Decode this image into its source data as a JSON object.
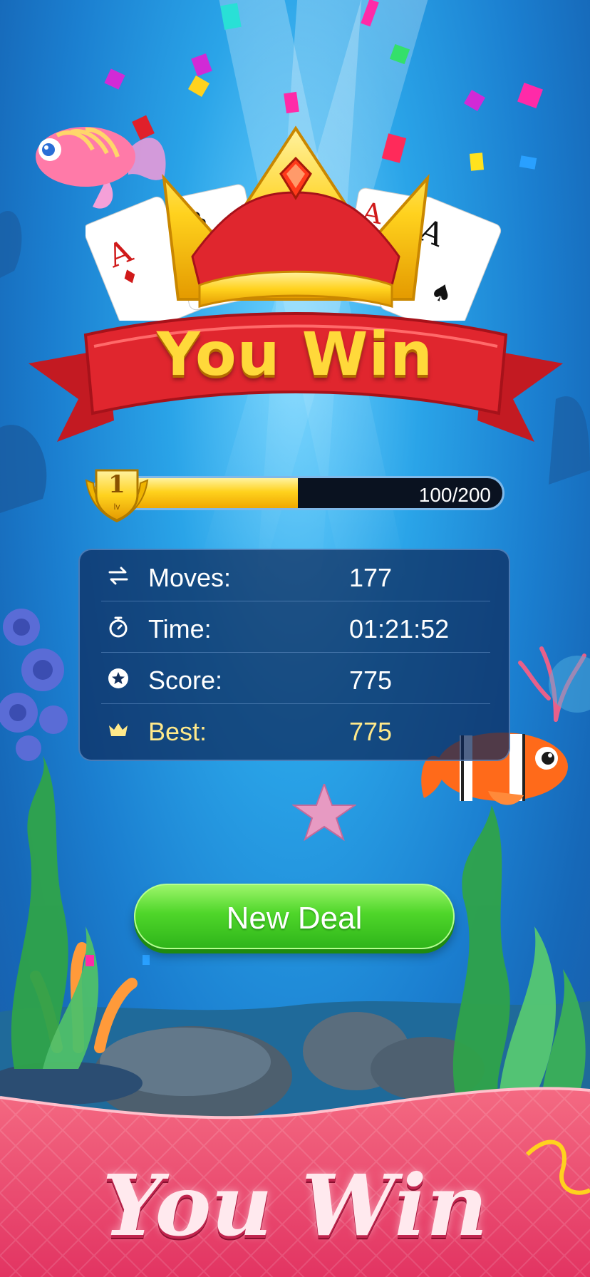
{
  "title": "You Win",
  "level": {
    "number": "1",
    "unit": "lv"
  },
  "progress": {
    "current": 100,
    "max": 200,
    "text": "100/200"
  },
  "stats": [
    {
      "icon": "swap-arrows-icon",
      "label": "Moves:",
      "value": "177"
    },
    {
      "icon": "stopwatch-icon",
      "label": "Time:",
      "value": "01:21:52"
    },
    {
      "icon": "star-badge-icon",
      "label": "Score:",
      "value": "775"
    },
    {
      "icon": "crown-icon",
      "label": "Best:",
      "value": "775"
    }
  ],
  "button": {
    "label": "New Deal"
  },
  "banner": {
    "text": "You Win"
  },
  "colors": {
    "accent_gold": "#ffd93a",
    "button_green": "#4fd62a",
    "ribbon_red": "#e0262e",
    "banner_pink": "#f2557a"
  }
}
